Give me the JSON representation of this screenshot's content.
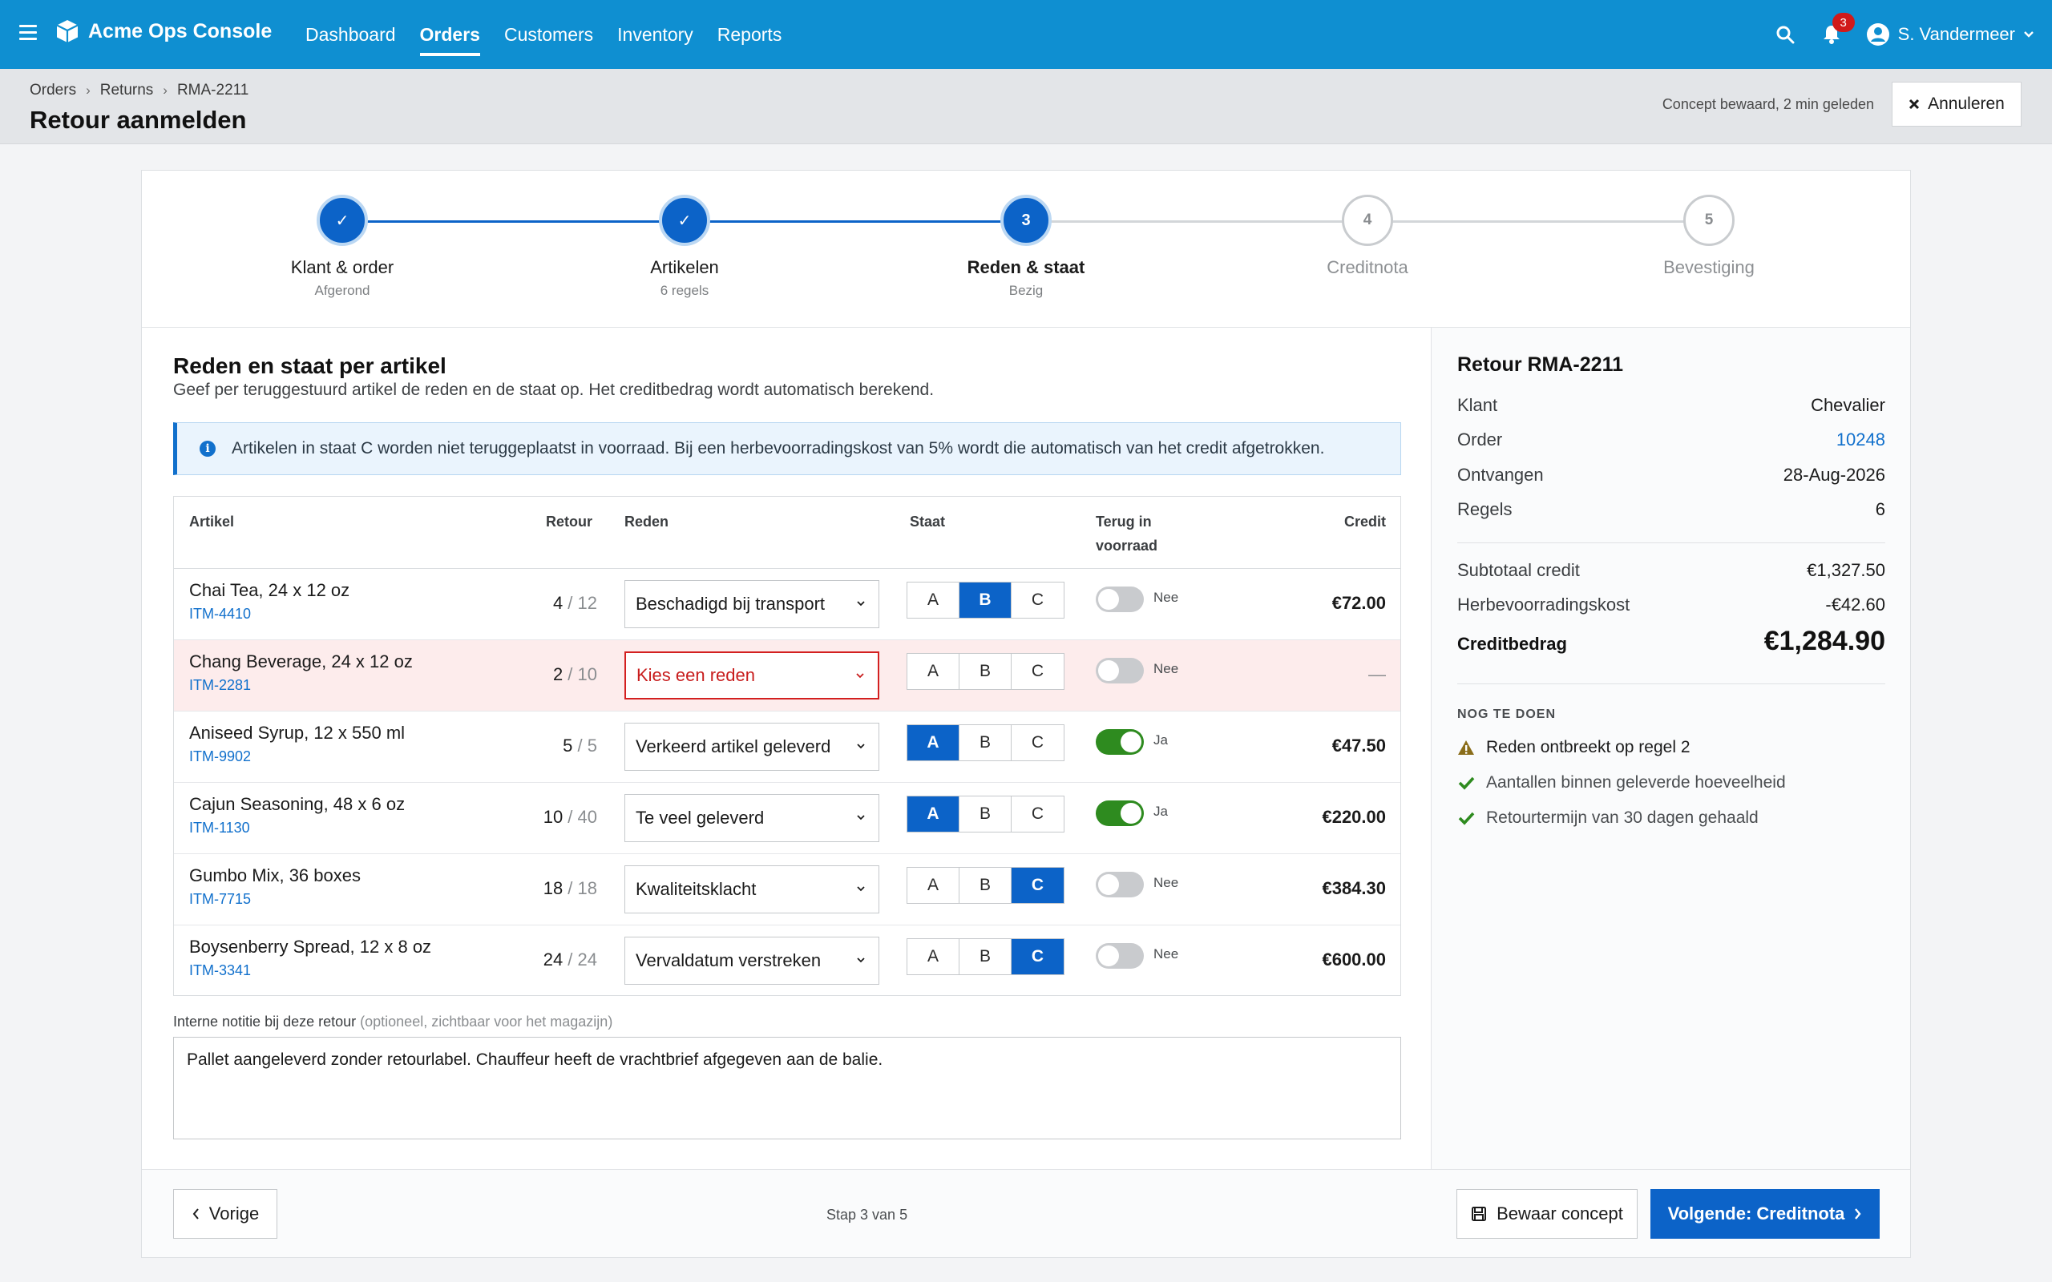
{
  "app": {
    "brand": "Acme Ops Console",
    "nav": [
      "Dashboard",
      "Orders",
      "Customers",
      "Inventory",
      "Reports"
    ],
    "active_nav": "Orders",
    "notification_count": "3",
    "user_name": "S. Vandermeer"
  },
  "header": {
    "breadcrumb": [
      "Orders",
      "Returns",
      "RMA-2211"
    ],
    "title": "Retour aanmelden",
    "saved_note": "Concept bewaard, 2 min geleden",
    "cancel_label": "Annuleren"
  },
  "stepper": [
    {
      "num": "1",
      "label": "Klant & order",
      "sub": "Afgerond",
      "state": "done"
    },
    {
      "num": "2",
      "label": "Artikelen",
      "sub": "6 regels",
      "state": "done"
    },
    {
      "num": "3",
      "label": "Reden & staat",
      "sub": "Bezig",
      "state": "current"
    },
    {
      "num": "4",
      "label": "Creditnota",
      "sub": "",
      "state": "todo"
    },
    {
      "num": "5",
      "label": "Bevestiging",
      "sub": "",
      "state": "todo"
    }
  ],
  "main": {
    "title": "Reden en staat per artikel",
    "description": "Geef per teruggestuurd artikel de reden en de staat op. Het creditbedrag wordt automatisch berekend.",
    "info": "Artikelen in staat C worden niet teruggeplaatst in voorraad. Bij een herbevoorradingskost van 5% wordt die automatisch van het credit afgetrokken.",
    "columns": {
      "artikel": "Artikel",
      "retour": "Retour",
      "reden": "Reden",
      "staat": "Staat",
      "terug_1": "Terug in",
      "terug_2": "voorraad",
      "credit": "Credit"
    },
    "rows": [
      {
        "name": "Chai Tea, 24 x 12 oz",
        "sku": "ITM-4410",
        "qty": "4",
        "of": " / 12",
        "reason": "Beschadigd bij transport",
        "invalid": false,
        "state": "B",
        "restock": false,
        "restock_label": "Nee",
        "credit": "€72.00"
      },
      {
        "name": "Chang Beverage, 24 x 12 oz",
        "sku": "ITM-2281",
        "qty": "2",
        "of": " / 10",
        "reason": "Kies een reden",
        "invalid": true,
        "state": "",
        "restock": false,
        "restock_label": "Nee",
        "credit": "—"
      },
      {
        "name": "Aniseed Syrup, 12 x 550 ml",
        "sku": "ITM-9902",
        "qty": "5",
        "of": " / 5",
        "reason": "Verkeerd artikel geleverd",
        "invalid": false,
        "state": "A",
        "restock": true,
        "restock_label": "Ja",
        "credit": "€47.50"
      },
      {
        "name": "Cajun Seasoning, 48 x 6 oz",
        "sku": "ITM-1130",
        "qty": "10",
        "of": " / 40",
        "reason": "Te veel geleverd",
        "invalid": false,
        "state": "A",
        "restock": true,
        "restock_label": "Ja",
        "credit": "€220.00"
      },
      {
        "name": "Gumbo Mix, 36 boxes",
        "sku": "ITM-7715",
        "qty": "18",
        "of": " / 18",
        "reason": "Kwaliteitsklacht",
        "invalid": false,
        "state": "C",
        "restock": false,
        "restock_label": "Nee",
        "credit": "€384.30"
      },
      {
        "name": "Boysenberry Spread, 12 x 8 oz",
        "sku": "ITM-3341",
        "qty": "24",
        "of": " / 24",
        "reason": "Vervaldatum verstreken",
        "invalid": false,
        "state": "C",
        "restock": false,
        "restock_label": "Nee",
        "credit": "€600.00"
      }
    ],
    "state_options": [
      "A",
      "B",
      "C"
    ],
    "note_label": "Interne notitie bij deze retour",
    "note_hint": " (optioneel, zichtbaar voor het magazijn)",
    "note_value": "Pallet aangeleverd zonder retourlabel. Chauffeur heeft de vrachtbrief afgegeven aan de balie."
  },
  "sidebar": {
    "title": "Retour RMA-2211",
    "details": [
      {
        "k": "Klant",
        "v": "Chevalier",
        "link": false
      },
      {
        "k": "Order",
        "v": "10248",
        "link": true
      },
      {
        "k": "Ontvangen",
        "v": "28-Aug-2026",
        "link": false
      },
      {
        "k": "Regels",
        "v": "6",
        "link": false
      }
    ],
    "subtotal_label": "Subtotaal credit",
    "subtotal": "€1,327.50",
    "restock_fee_label": "Herbevoorradingskost",
    "restock_fee": "-€42.60",
    "total_label": "Creditbedrag",
    "total": "€1,284.90",
    "todo_title": "NOG TE DOEN",
    "todos": [
      {
        "text": "Reden ontbreekt op regel 2",
        "status": "warn"
      },
      {
        "text": "Aantallen binnen geleverde hoeveelheid",
        "status": "ok"
      },
      {
        "text": "Retourtermijn van 30 dagen gehaald",
        "status": "ok"
      }
    ]
  },
  "footer": {
    "prev_label": "Vorige",
    "step_count": "Stap 3 van 5",
    "draft_label": "Bewaar concept",
    "next_label": "Volgende: Creditnota"
  },
  "colors": {
    "nav_bg": "#0f8fd1",
    "primary": "#0c63c8",
    "error": "#d32020",
    "success": "#2e8b1f",
    "warning": "#8a6d1a"
  },
  "icons": {
    "menu": "hamburger-icon",
    "brand": "box-icon",
    "search": "search-icon",
    "notifications": "bell-icon",
    "user": "user-circle-icon",
    "info": "info-icon",
    "warning": "warning-triangle-icon",
    "ok": "check-icon",
    "save": "floppy-icon"
  }
}
